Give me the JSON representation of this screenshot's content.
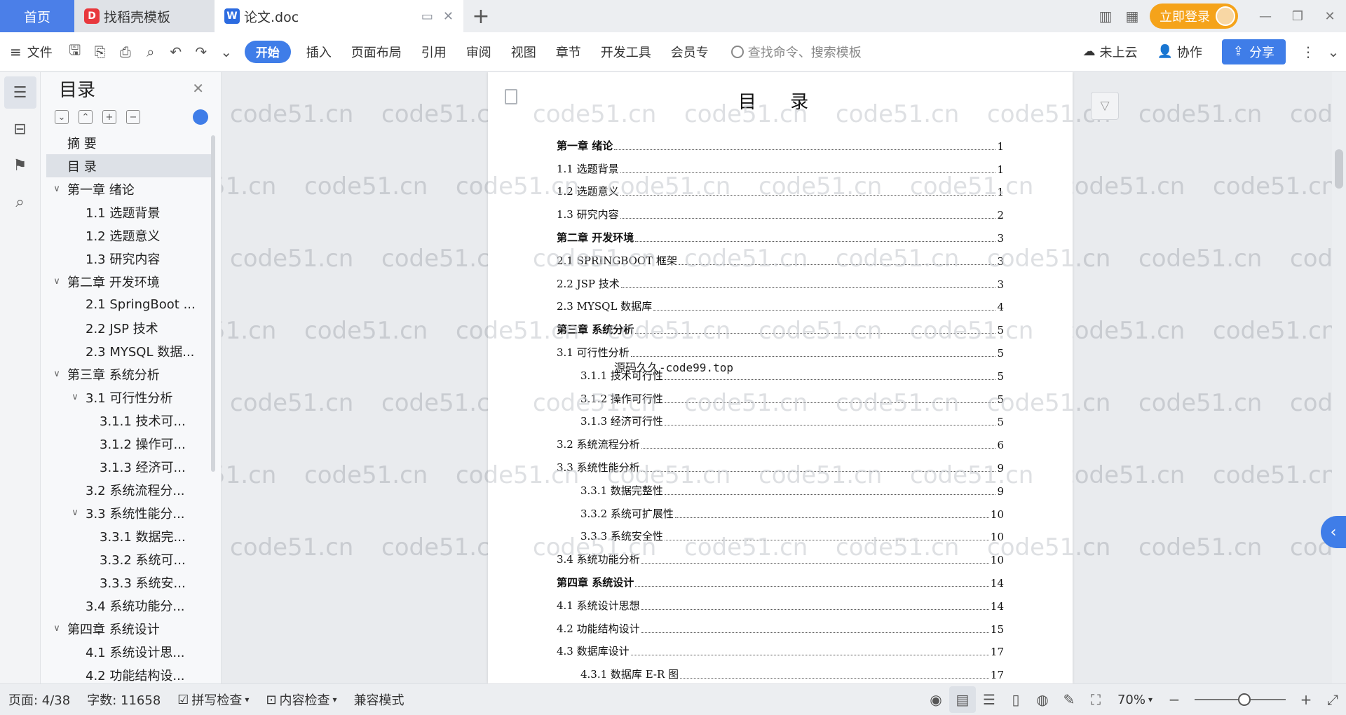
{
  "tabs": {
    "home": "首页",
    "template": "找稻壳模板",
    "doc": "论文.doc"
  },
  "topbar": {
    "login": "立即登录"
  },
  "ribbon": {
    "file": "文件",
    "active": "开始",
    "menus": [
      "插入",
      "页面布局",
      "引用",
      "审阅",
      "视图",
      "章节",
      "开发工具",
      "会员专"
    ],
    "search_placeholder": "查找命令、搜索模板",
    "cloud": "未上云",
    "collab": "协作",
    "share": "分享"
  },
  "toc_panel": {
    "title": "目录",
    "items": [
      {
        "label": "摘  要",
        "level": 1,
        "chev": ""
      },
      {
        "label": "目  录",
        "level": 1,
        "chev": "",
        "selected": true
      },
      {
        "label": "第一章  绪论",
        "level": 1,
        "chev": "∨"
      },
      {
        "label": "1.1  选题背景",
        "level": 2,
        "chev": ""
      },
      {
        "label": "1.2  选题意义",
        "level": 2,
        "chev": ""
      },
      {
        "label": "1.3  研究内容",
        "level": 2,
        "chev": ""
      },
      {
        "label": "第二章  开发环境",
        "level": 1,
        "chev": "∨"
      },
      {
        "label": "2.1 SpringBoot ...",
        "level": 2,
        "chev": ""
      },
      {
        "label": "2.2 JSP 技术",
        "level": 2,
        "chev": ""
      },
      {
        "label": "2.3 MYSQL 数据...",
        "level": 2,
        "chev": ""
      },
      {
        "label": "第三章  系统分析",
        "level": 1,
        "chev": "∨"
      },
      {
        "label": "3.1 可行性分析",
        "level": 2,
        "chev": "∨"
      },
      {
        "label": "3.1.1 技术可...",
        "level": 3,
        "chev": ""
      },
      {
        "label": "3.1.2 操作可...",
        "level": 3,
        "chev": ""
      },
      {
        "label": "3.1.3 经济可...",
        "level": 3,
        "chev": ""
      },
      {
        "label": "3.2 系统流程分...",
        "level": 2,
        "chev": ""
      },
      {
        "label": "3.3 系统性能分...",
        "level": 2,
        "chev": "∨"
      },
      {
        "label": "3.3.1 数据完...",
        "level": 3,
        "chev": ""
      },
      {
        "label": "3.3.2 系统可...",
        "level": 3,
        "chev": ""
      },
      {
        "label": "3.3.3 系统安...",
        "level": 3,
        "chev": ""
      },
      {
        "label": "3.4 系统功能分...",
        "level": 2,
        "chev": ""
      },
      {
        "label": "第四章  系统设计",
        "level": 1,
        "chev": "∨"
      },
      {
        "label": "4.1  系统设计思...",
        "level": 2,
        "chev": ""
      },
      {
        "label": "4.2 功能结构设...",
        "level": 2,
        "chev": ""
      }
    ]
  },
  "document": {
    "title": "目 录",
    "note": "源码久久-code99.top",
    "entries": [
      {
        "text": "第一章  绪论",
        "page": "1",
        "kind": "ch"
      },
      {
        "text": "1.1  选题背景",
        "page": "1",
        "kind": "l2"
      },
      {
        "text": "1.2  选题意义",
        "page": "1",
        "kind": "l2"
      },
      {
        "text": "1.3  研究内容",
        "page": "2",
        "kind": "l2"
      },
      {
        "text": "第二章  开发环境",
        "page": "3",
        "kind": "ch"
      },
      {
        "text": "2.1 SPRINGBOOT 框架",
        "page": "3",
        "kind": "l2"
      },
      {
        "text": "2.2 JSP 技术",
        "page": "3",
        "kind": "l2"
      },
      {
        "text": "2.3 MYSQL 数据库",
        "page": "4",
        "kind": "l2"
      },
      {
        "text": "第三章  系统分析",
        "page": "5",
        "kind": "ch"
      },
      {
        "text": "3.1 可行性分析",
        "page": "5",
        "kind": "l2"
      },
      {
        "text": "3.1.1 技术可行性",
        "page": "5",
        "kind": "l3"
      },
      {
        "text": "3.1.2 操作可行性",
        "page": "5",
        "kind": "l3"
      },
      {
        "text": "3.1.3 经济可行性",
        "page": "5",
        "kind": "l3"
      },
      {
        "text": "3.2 系统流程分析",
        "page": "6",
        "kind": "l2"
      },
      {
        "text": "3.3 系统性能分析",
        "page": "9",
        "kind": "l2"
      },
      {
        "text": "3.3.1 数据完整性",
        "page": "9",
        "kind": "l3"
      },
      {
        "text": "3.3.2 系统可扩展性",
        "page": "10",
        "kind": "l3"
      },
      {
        "text": "3.3.3 系统安全性",
        "page": "10",
        "kind": "l3"
      },
      {
        "text": "3.4 系统功能分析",
        "page": "10",
        "kind": "l2"
      },
      {
        "text": "第四章  系统设计",
        "page": "14",
        "kind": "ch"
      },
      {
        "text": "4.1  系统设计思想",
        "page": "14",
        "kind": "l2"
      },
      {
        "text": "4.2 功能结构设计",
        "page": "15",
        "kind": "l2"
      },
      {
        "text": "4.3 数据库设计",
        "page": "17",
        "kind": "l2"
      },
      {
        "text": "4.3.1  数据库 E-R 图",
        "page": "17",
        "kind": "l3"
      }
    ]
  },
  "watermark": "code51.cn",
  "statusbar": {
    "page": "页面: 4/38",
    "words": "字数: 11658",
    "spell": "拼写检查",
    "content": "内容检查",
    "mode": "兼容模式",
    "zoom": "70%"
  },
  "colors": {
    "accent": "#3f7de8",
    "login": "#f5a31a",
    "wps_red": "#e8383d"
  }
}
